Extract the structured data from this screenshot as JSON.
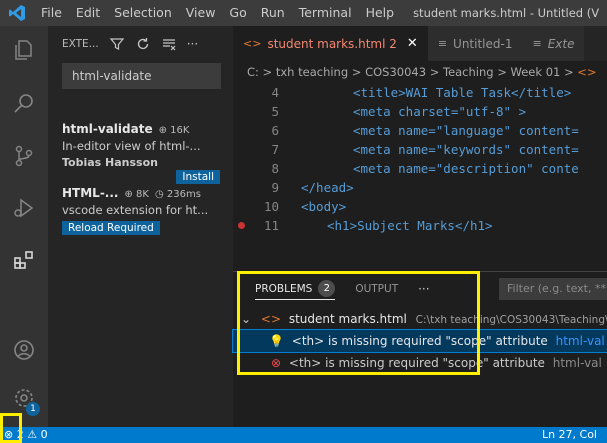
{
  "menu": [
    "File",
    "Edit",
    "Selection",
    "View",
    "Go",
    "Run",
    "Terminal",
    "Help"
  ],
  "window_title": "student marks.html - Untitled (V",
  "activity": {
    "badge": "1"
  },
  "sidebar": {
    "title": "EXTE...",
    "search_value": "html-validate",
    "ext1": {
      "name": "html-validate",
      "downloads": "16K",
      "description": "In-editor view of html-...",
      "publisher": "Tobias Hansson",
      "install_label": "Install"
    },
    "ext2": {
      "name": "HTML-...",
      "downloads": "8K",
      "time": "236ms",
      "description": "vscode extension for ht...",
      "reload_label": "Reload Required"
    }
  },
  "tabs": [
    {
      "label": "student marks.html",
      "count": "2",
      "close": "✕"
    },
    {
      "label": "Untitled-1"
    },
    {
      "label": "Exte"
    }
  ],
  "breadcrumb": "C: > txh teaching > COS30043 > Teaching > Week 01 >",
  "code_lines": [
    {
      "n": "4",
      "content": "<title>WAI Table Task</title>"
    },
    {
      "n": "5",
      "content": "<meta charset=\"utf-8\" >"
    },
    {
      "n": "6",
      "content": "<meta name=\"language\" content="
    },
    {
      "n": "7",
      "content": "<meta name=\"keywords\" content="
    },
    {
      "n": "8",
      "content": "<meta name=\"description\" conte"
    },
    {
      "n": "9",
      "content": "</head>"
    },
    {
      "n": "10",
      "content": "<body>"
    },
    {
      "n": "11",
      "content": "<h1>Subject Marks</h1>"
    }
  ],
  "panel": {
    "problems_label": "PROBLEMS",
    "problems_count": "2",
    "output_label": "OUTPUT",
    "more": "···",
    "filter_placeholder": "Filter (e.g. text, **",
    "file_name": "student marks.html",
    "file_path": "C:\\txh teaching\\COS30043\\Teaching\\",
    "problems": [
      {
        "message": "<th> is missing required \"scope\" attribute",
        "source": "html-val"
      },
      {
        "message": "<th> is missing required \"scope\" attribute",
        "source": "html-val"
      }
    ]
  },
  "status": {
    "errors": "2",
    "warnings": "0",
    "position": "Ln 27, Col"
  }
}
